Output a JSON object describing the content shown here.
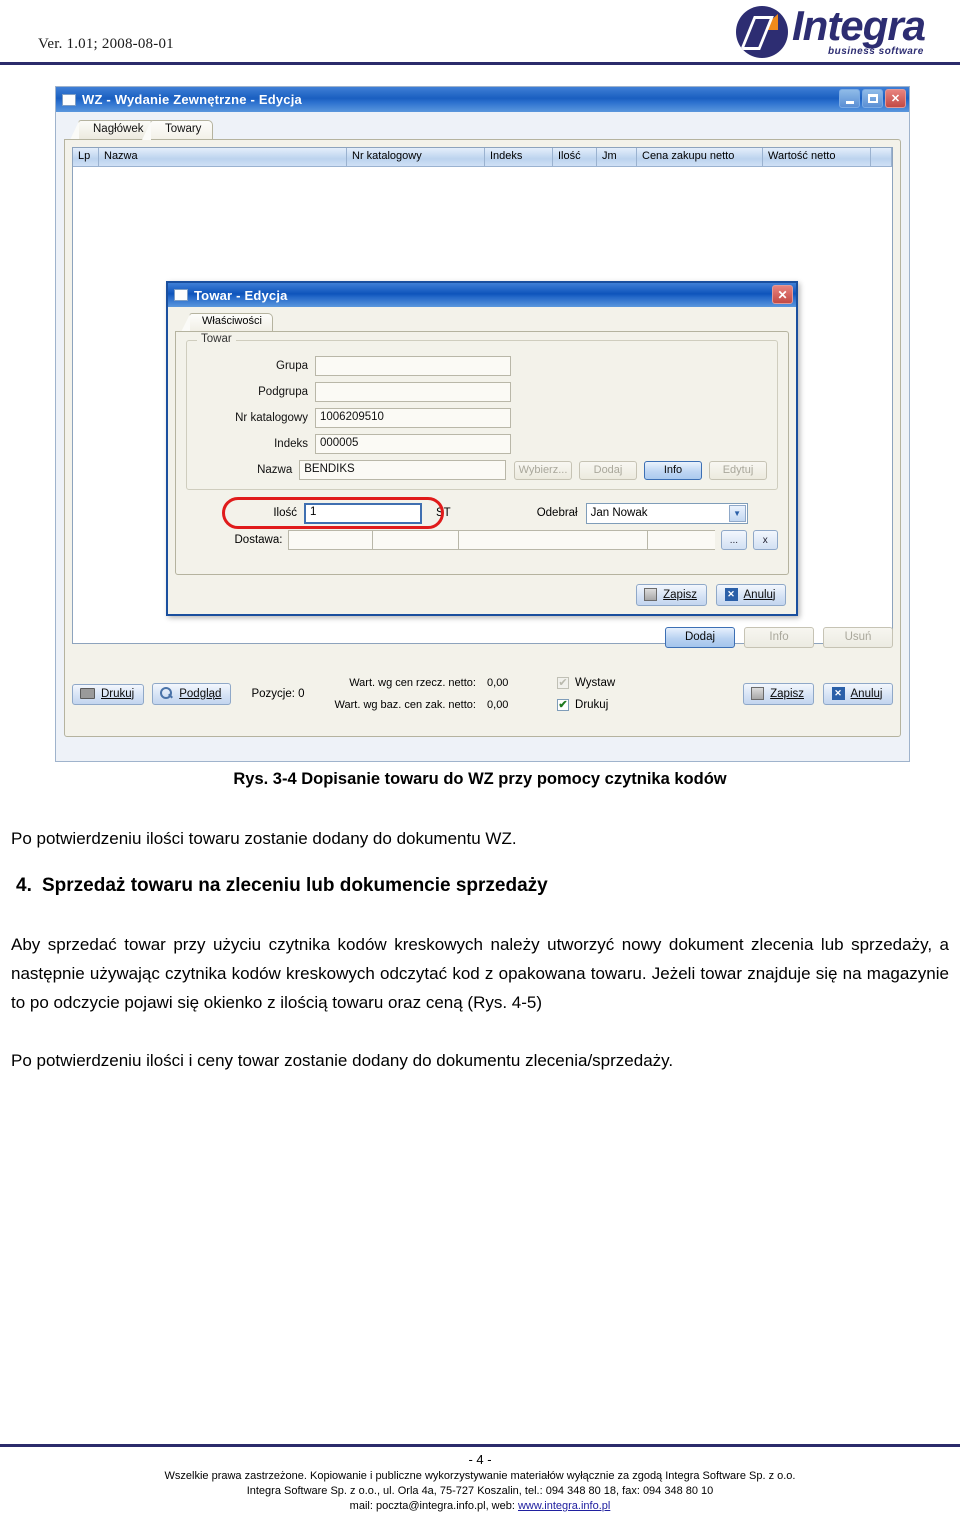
{
  "header": {
    "version_text": "Ver. 1.01; 2008-08-01",
    "logo_name": "Integra",
    "logo_tagline": "business software",
    "accent_color": "#2d2d72",
    "logo_accent_color": "#f08a1c"
  },
  "screenshot": {
    "window": {
      "title": "WZ - Wydanie Zewnętrzne - Edycja",
      "minimize_label": "_",
      "maximize_label": "□",
      "close_label": "✕",
      "tabs": [
        {
          "label": "Nagłówek",
          "active": false
        },
        {
          "label": "Towary",
          "active": true
        }
      ],
      "grid": {
        "columns": [
          "Lp",
          "Nazwa",
          "Nr katalogowy",
          "Indeks",
          "Ilość",
          "Jm",
          "Cena zakupu netto",
          "Wartość netto"
        ],
        "rows": []
      },
      "grid_buttons": [
        {
          "label": "Dodaj",
          "state": "primary"
        },
        {
          "label": "Info",
          "state": "disabled"
        },
        {
          "label": "Usuń",
          "state": "disabled"
        }
      ],
      "bottom_bar": {
        "print_button": "Drukuj",
        "preview_button": "Podgląd",
        "positions_label": "Pozycje: 0",
        "total_real_label": "Wart. wg cen rzecz. netto:",
        "total_real_value": "0,00",
        "total_base_label": "Wart. wg baz. cen zak. netto:",
        "total_base_value": "0,00",
        "checkbox_issue_label": "Wystaw",
        "checkbox_issue_checked": true,
        "checkbox_issue_enabled": false,
        "checkbox_print_label": "Drukuj",
        "checkbox_print_checked": true,
        "save_button": "Zapisz",
        "cancel_button": "Anuluj"
      }
    },
    "dialog": {
      "title": "Towar - Edycja",
      "close_label": "✕",
      "tab_label": "Właściwości",
      "group_legend": "Towar",
      "fields": [
        {
          "label": "Grupa",
          "value": ""
        },
        {
          "label": "Podgrupa",
          "value": ""
        },
        {
          "label": "Nr katalogowy",
          "value": "1006209510"
        },
        {
          "label": "Indeks",
          "value": "000005"
        },
        {
          "label": "Nazwa",
          "value": "BENDIKS"
        }
      ],
      "name_buttons": [
        {
          "label": "Wybierz...",
          "state": "disabled"
        },
        {
          "label": "Dodaj",
          "state": "disabled"
        },
        {
          "label": "Info",
          "state": "active"
        },
        {
          "label": "Edytuj",
          "state": "disabled"
        }
      ],
      "quantity": {
        "label": "Ilość",
        "value": "1",
        "unit": "ST",
        "highlight_color": "#e01b1b"
      },
      "receiver": {
        "label": "Odebrał",
        "value": "Jan Nowak",
        "arrow": "▼"
      },
      "delivery": {
        "label": "Dostawa:",
        "cells": [
          "",
          "",
          "",
          ""
        ],
        "browse_button": "...",
        "clear_button": "x"
      },
      "save_button": "Zapisz",
      "cancel_button": "Anuluj"
    }
  },
  "document": {
    "figure_caption": "Rys. 3-4 Dopisanie towaru do WZ przy pomocy czytnika kodów",
    "paragraph_1": "Po potwierdzeniu ilości towaru zostanie dodany do dokumentu WZ.",
    "section_number": "4.",
    "section_title": "Sprzedaż towaru na zleceniu lub dokumencie sprzedaży",
    "paragraph_2": "Aby sprzedać towar przy użyciu czytnika kodów kreskowych należy utworzyć nowy dokument zlecenia lub sprzedaży, a następnie używając czytnika kodów kreskowych odczytać kod z opakowana towaru. Jeżeli towar znajduje się na magazynie to po odczycie pojawi się okienko z ilością towaru oraz ceną (Rys. 4-5)",
    "paragraph_3": "Po potwierdzeniu ilości i ceny towar zostanie dodany do dokumentu zlecenia/sprzedaży."
  },
  "footer": {
    "page_number": "- 4 -",
    "line_1": "Wszelkie prawa zastrzeżone. Kopiowanie i publiczne wykorzystywanie materiałów wyłącznie za zgodą Integra Software Sp. z o.o.",
    "line_2": "Integra Software Sp. z o.o., ul. Orla 4a, 75-727 Koszalin, tel.: 094 348 80 18, fax: 094 348 80 10",
    "line_3_prefix": "mail: poczta@integra.info.pl, web: ",
    "line_3_link": "www.integra.info.pl"
  }
}
